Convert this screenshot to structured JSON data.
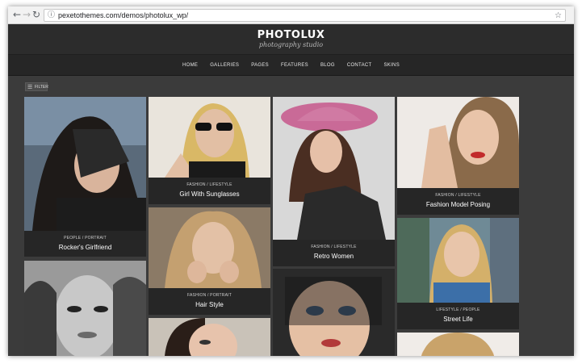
{
  "browser": {
    "back_icon": "arrow-left-icon",
    "forward_icon": "arrow-right-icon",
    "reload_icon": "reload-icon",
    "info_icon": "info-icon",
    "star_icon": "star-icon",
    "url": "pexetothemes.com/demos/photolux_wp/"
  },
  "site": {
    "logo": "PHOTOLUX",
    "tagline": "photography studio",
    "menu": [
      "HOME",
      "GALLERIES",
      "PAGES",
      "FEATURES",
      "BLOG",
      "CONTACT",
      "SKINS"
    ],
    "filter_label": "FILTER"
  },
  "gallery": [
    {
      "category": "PEOPLE / PORTRAIT",
      "title": "Rocker's Girlfriend"
    },
    {
      "category": "FASHION / LIFESTYLE",
      "title": "Girl With Sunglasses"
    },
    {
      "category": "FASHION / PORTRAIT",
      "title": "Hair Style"
    },
    {
      "category": "FASHION / LIFESTYLE",
      "title": "Retro Women"
    },
    {
      "category": "FASHION / LIFESTYLE",
      "title": "Fashion Model Posing"
    },
    {
      "category": "LIFESTYLE / PEOPLE",
      "title": "Street Life"
    }
  ],
  "colors": {
    "page_bg": "#3b3b3b",
    "header_bg": "#2c2c2c",
    "caption_bg": "#262626"
  }
}
